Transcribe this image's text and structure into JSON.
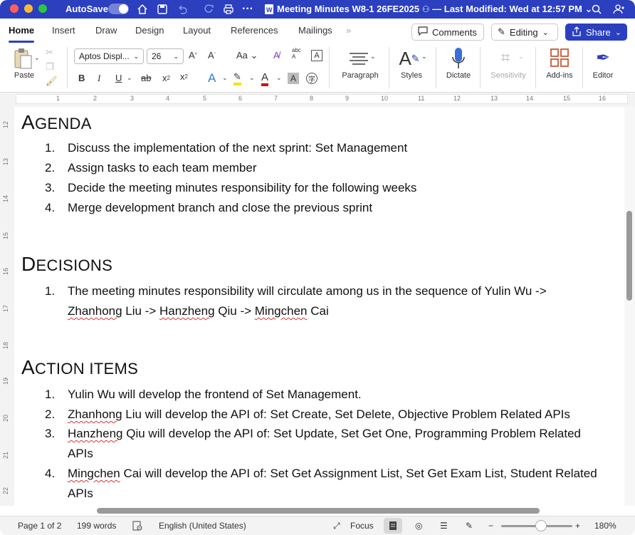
{
  "titlebar": {
    "autosave_label": "AutoSave",
    "title": "Meeting Minutes W8-1 26FE2025",
    "modified": "— Last Modified: Wed at 12:57 PM"
  },
  "tabs": [
    "Home",
    "Insert",
    "Draw",
    "Design",
    "Layout",
    "References",
    "Mailings"
  ],
  "ribbon_right": {
    "comments": "Comments",
    "editing": "Editing",
    "share": "Share"
  },
  "toolbar": {
    "paste": "Paste",
    "font_name": "Aptos Displ...",
    "font_size": "26",
    "paragraph": "Paragraph",
    "styles": "Styles",
    "dictate": "Dictate",
    "sensitivity": "Sensitivity",
    "addins": "Add-ins",
    "editor": "Editor",
    "bold": "B",
    "italic": "I",
    "underline": "U",
    "strike": "ab",
    "sub": "x",
    "sup": "x"
  },
  "ruler": [
    "1",
    "2",
    "3",
    "4",
    "5",
    "6",
    "7",
    "8",
    "9",
    "10",
    "11",
    "12",
    "13",
    "14",
    "15",
    "16"
  ],
  "vruler": [
    "12",
    "13",
    "14",
    "15",
    "16",
    "17",
    "18",
    "19",
    "20",
    "21",
    "22"
  ],
  "document": {
    "agenda_heading_first": "A",
    "agenda_heading_rest": "GENDA",
    "agenda": [
      "Discuss the implementation of the next sprint: Set Management",
      "Assign tasks to each team member",
      "Decide the meeting minutes responsibility for the following weeks",
      "Merge development branch and close the previous sprint"
    ],
    "decisions_heading_first": "D",
    "decisions_heading_rest": "ECISIONS",
    "decision_line1": "The meeting minutes responsibility will circulate among us in the sequence of Yulin Wu ->",
    "decision_line2_a": "Zhanhong",
    "decision_line2_b": " Liu -> ",
    "decision_line2_c": "Hanzheng",
    "decision_line2_d": " Qiu -> ",
    "decision_line2_e": "Mingchen",
    "decision_line2_f": " Cai",
    "actions_heading_first": "A",
    "actions_heading_rest": "CTION ITEMS",
    "action1": "Yulin Wu will develop the frontend of Set Management.",
    "action2_name": "Zhanhong",
    "action2_rest": " Liu will develop the API of: Set Create, Set Delete, Objective Problem Related APIs",
    "action3_name": "Hanzheng",
    "action3_rest": " Qiu will develop the API of: Set Update, Set Get One, Programming Problem Related",
    "action3_cont": "APIs",
    "action4_name": "Mingchen",
    "action4_rest": " Cai will develop the API of: Set Get Assignment List, Set Get Exam List, Student Related",
    "action4_cont": "APIs",
    "numbers": [
      "1.",
      "2.",
      "3.",
      "4."
    ]
  },
  "status": {
    "page": "Page 1 of 2",
    "words": "199 words",
    "language": "English (United States)",
    "focus": "Focus",
    "zoom_minus": "−",
    "zoom_plus": "+",
    "zoom": "180%"
  },
  "colors": {
    "accent": "#2b3fbf",
    "close": "#ff5f57",
    "minimize": "#febc2e",
    "maximize": "#28c840"
  }
}
